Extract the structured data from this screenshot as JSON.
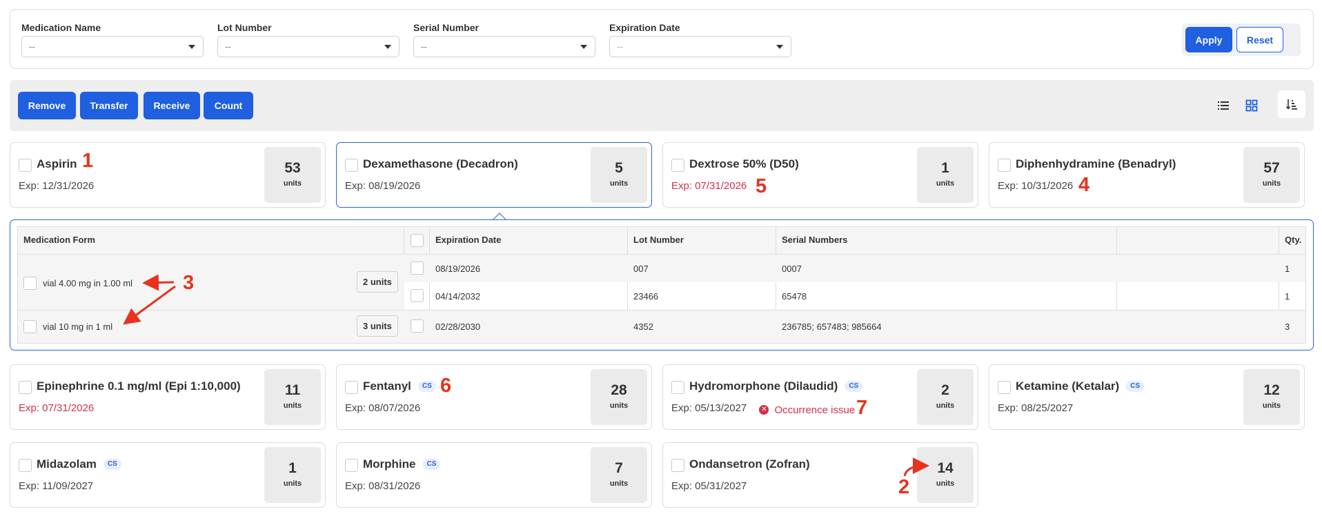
{
  "filters": {
    "fields": [
      {
        "label": "Medication Name",
        "value": "--"
      },
      {
        "label": "Lot Number",
        "value": "--"
      },
      {
        "label": "Serial Number",
        "value": "--"
      },
      {
        "label": "Expiration Date",
        "value": "--"
      }
    ],
    "apply_label": "Apply",
    "reset_label": "Reset"
  },
  "actions": {
    "remove_label": "Remove",
    "transfer_label": "Transfer",
    "receive_label": "Receive",
    "count_label": "Count",
    "view_icons": [
      "list-view-icon",
      "grid-view-icon",
      "sort-icon"
    ]
  },
  "cards": [
    {
      "name": "Aspirin",
      "cs": false,
      "exp": "Exp: 12/31/2026",
      "expired": false,
      "qty": "53",
      "unit": "units"
    },
    {
      "name": "Dexamethasone (Decadron)",
      "cs": false,
      "exp": "Exp: 08/19/2026",
      "expired": false,
      "qty": "5",
      "unit": "units"
    },
    {
      "name": "Dextrose 50% (D50)",
      "cs": false,
      "exp": "Exp: 07/31/2026",
      "expired": true,
      "qty": "1",
      "unit": "units"
    },
    {
      "name": "Diphenhydramine (Benadryl)",
      "cs": false,
      "exp": "Exp: 10/31/2026",
      "expired": false,
      "qty": "57",
      "unit": "units"
    },
    {
      "name": "Epinephrine 0.1 mg/ml (Epi 1:10,000)",
      "cs": false,
      "exp": "Exp: 07/31/2026",
      "expired": true,
      "qty": "11",
      "unit": "units"
    },
    {
      "name": "Fentanyl",
      "cs": true,
      "exp": "Exp: 08/07/2026",
      "expired": false,
      "qty": "28",
      "unit": "units"
    },
    {
      "name": "Hydromorphone (Dilaudid)",
      "cs": true,
      "exp": "Exp: 05/13/2027",
      "expired": false,
      "qty": "2",
      "unit": "units",
      "issue": "Occurrence issue"
    },
    {
      "name": "Ketamine (Ketalar)",
      "cs": true,
      "exp": "Exp: 08/25/2027",
      "expired": false,
      "qty": "12",
      "unit": "units"
    },
    {
      "name": "Midazolam",
      "cs": true,
      "exp": "Exp: 11/09/2027",
      "expired": false,
      "qty": "1",
      "unit": "units"
    },
    {
      "name": "Morphine",
      "cs": true,
      "exp": "Exp: 08/31/2026",
      "expired": false,
      "qty": "7",
      "unit": "units"
    },
    {
      "name": "Ondansetron (Zofran)",
      "cs": false,
      "exp": "Exp: 05/31/2027",
      "expired": false,
      "qty": "14",
      "unit": "units"
    }
  ],
  "cs_label": "CS",
  "detail": {
    "headers": {
      "form": "Medication Form",
      "expiration": "Expiration Date",
      "lot": "Lot Number",
      "serials": "Serial Numbers",
      "blank": "",
      "qty": "Qty."
    },
    "forms": [
      {
        "label": "vial 4.00 mg in 1.00 ml",
        "units": "2 units"
      },
      {
        "label": "vial 10 mg in 1 ml",
        "units": "3 units"
      }
    ],
    "rows": [
      {
        "expiration": "08/19/2026",
        "lot": "007",
        "serials": "0007",
        "qty": "1"
      },
      {
        "expiration": "04/14/2032",
        "lot": "23466",
        "serials": "65478",
        "qty": "1"
      },
      {
        "expiration": "02/28/2030",
        "lot": "4352",
        "serials": "236785; 657483; 985664",
        "qty": "3"
      }
    ]
  },
  "annotations": [
    "1",
    "2",
    "3",
    "4",
    "5",
    "6",
    "7"
  ],
  "colors": {
    "accent": "#1f5fe0",
    "expired": "#d0324a",
    "annotation": "#e8321c",
    "panel": "#eeeeee"
  }
}
